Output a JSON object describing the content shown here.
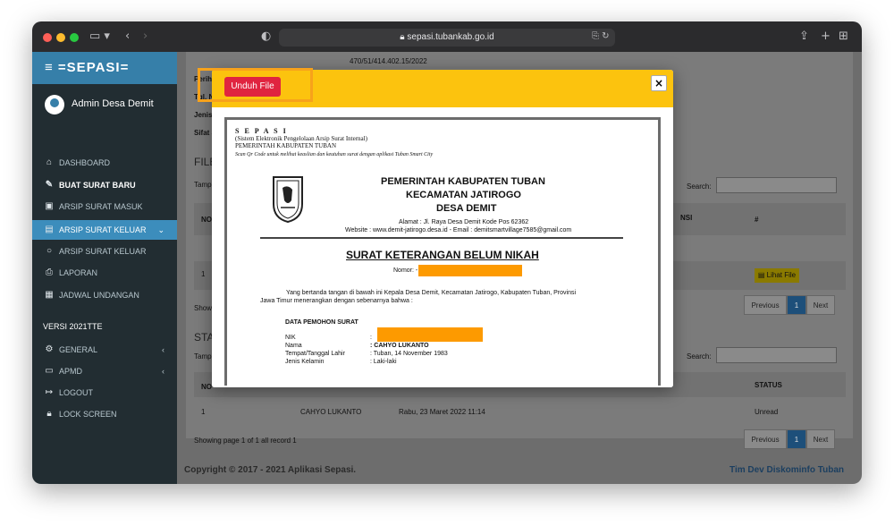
{
  "browser": {
    "url": "sepasi.tubankab.go.id",
    "colors": {
      "close": "#ff5f57",
      "minimize": "#febc2e",
      "maximize": "#28c840"
    }
  },
  "sidebar": {
    "brand": "=SEPASI=",
    "user_name": "Admin Desa Demit",
    "items": [
      {
        "label": "DASHBOARD",
        "icon": "dashboard-icon"
      },
      {
        "label": "BUAT SURAT BARU",
        "icon": "pen-icon"
      },
      {
        "label": "ARSIP SURAT MASUK",
        "icon": "inbox-icon"
      },
      {
        "label": "ARSIP SURAT KELUAR",
        "icon": "outbox-icon"
      },
      {
        "label": "ARSIP SURAT KELUAR",
        "icon": "circle-icon"
      },
      {
        "label": "LAPORAN",
        "icon": "print-icon"
      },
      {
        "label": "JADWAL UNDANGAN",
        "icon": "calendar-icon"
      }
    ],
    "version": "VERSI 2021TTE",
    "items2": [
      {
        "label": "GENERAL",
        "icon": "gear-icon"
      },
      {
        "label": "APMD",
        "icon": "id-card-icon"
      },
      {
        "label": "LOGOUT",
        "icon": "logout-icon"
      },
      {
        "label": "LOCK SCREEN",
        "icon": "lock-icon"
      }
    ]
  },
  "background": {
    "nomor_value": "470/51/414.402.15/2022",
    "perihal_label": "Periha",
    "tgl_label": "Tgl. N",
    "jenis_label": "Jenis",
    "sifat_label": "Sifat S",
    "file_heading": "FILE",
    "tampil_label": "Tampi",
    "search_label": "Search:",
    "col_no": "NO",
    "col_nsi": "NSI",
    "col_hash": "#",
    "row_no": "1",
    "lihat_file": "Lihat File",
    "show_label": "Showi",
    "previous": "Previous",
    "page": "1",
    "next": "Next",
    "stat_heading": "STAT",
    "col_status": "STATUS",
    "row2_name": "CAHYO LUKANTO",
    "row2_date": "Rabu, 23 Maret 2022 11:14",
    "row2_status": "Unread",
    "showing": "Showing page 1 of 1 all record 1"
  },
  "footer": {
    "copyright": "Copyright © 2017 - 2021 Aplikasi Sepasi.",
    "team": "Tim Dev Diskominfo Tuban"
  },
  "modal": {
    "download_label": "Unduh File",
    "close_label": "×",
    "doc": {
      "brand": "S E P A S I",
      "system": "(Sistem Elektronik Pengelolaan Arsip Surat Internal)",
      "gov": "PEMERINTAH KABUPATEN TUBAN",
      "scan_note": "Scan Qr Code untuk melihat keaslian dan keutuhan surat dengan aplikasi Tuban Smart City",
      "kop1": "PEMERINTAH KABUPATEN TUBAN",
      "kop2": "KECAMATAN JATIROGO",
      "kop3": "DESA DEMIT",
      "alamat": "Alamat : Jl. Raya Desa Demit Kode Pos 62362",
      "website": "Website : www.demit-jatirogo.desa.id - Email : demitsmartvillage7585@gmail.com",
      "title": "SURAT KETERANGAN BELUM NIKAH",
      "nomor_label": "Nomor: -",
      "body1": "Yang bertanda tangan di bawah ini Kepala Desa Demit, Kecamatan Jatirogo, Kabupaten Tuban, Provinsi",
      "body2": "Jawa Timur menerangkan dengan sebenarnya bahwa :",
      "section": "DATA PEMOHON SURAT",
      "fields": [
        {
          "label": "NIK",
          "value": ":"
        },
        {
          "label": "Nama",
          "value": ":  CAHYO LUKANTO"
        },
        {
          "label": "Tempat/Tanggal Lahir",
          "value": ":  Tuban, 14 November 1983"
        },
        {
          "label": "Jenis Kelamin",
          "value": ":  Laki-laki"
        }
      ]
    }
  }
}
